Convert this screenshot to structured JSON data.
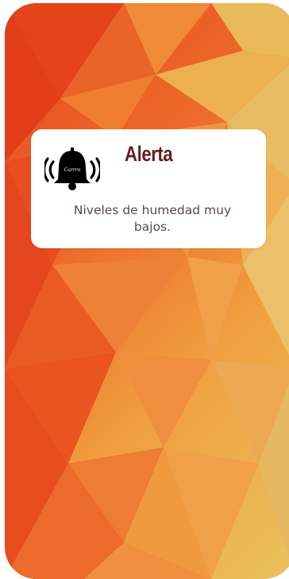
{
  "alert": {
    "title": "Alerta",
    "message": "Niveles de humedad muy bajos.",
    "icon": "bell-ringing-icon",
    "bell_text": "Carrro"
  },
  "colors": {
    "background_primary": "#e8461c",
    "background_secondary": "#f0a040",
    "background_tertiary": "#e9c25e",
    "title": "#651d1d",
    "message": "#5a4a4a",
    "card": "#ffffff"
  }
}
